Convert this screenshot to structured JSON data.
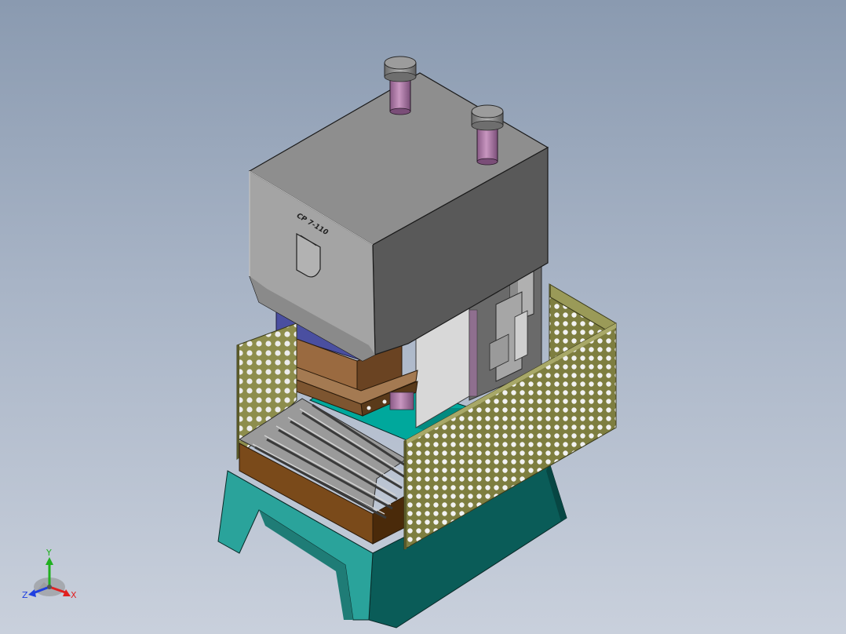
{
  "viewport": {
    "background_top": "#8a9ab0",
    "background_bottom": "#c9d0dc"
  },
  "model": {
    "nameplate_text": "CP 7-110",
    "colors": {
      "body_front": "#a4a4a4",
      "body_side": "#5a5a5a",
      "body_top": "#8e8e8e",
      "cylinder": "#b07aa6",
      "slide_block": "#4a4fa0",
      "upper_die": "#9a6a40",
      "bolster": "#7a4a1a",
      "table_top": "#009f95",
      "base": "#2aa39b",
      "guard_mesh": "#8a8a48"
    }
  },
  "triad": {
    "x_label": "X",
    "y_label": "Y",
    "z_label": "Z",
    "x_color": "#e02020",
    "y_color": "#20b020",
    "z_color": "#2040e0"
  }
}
